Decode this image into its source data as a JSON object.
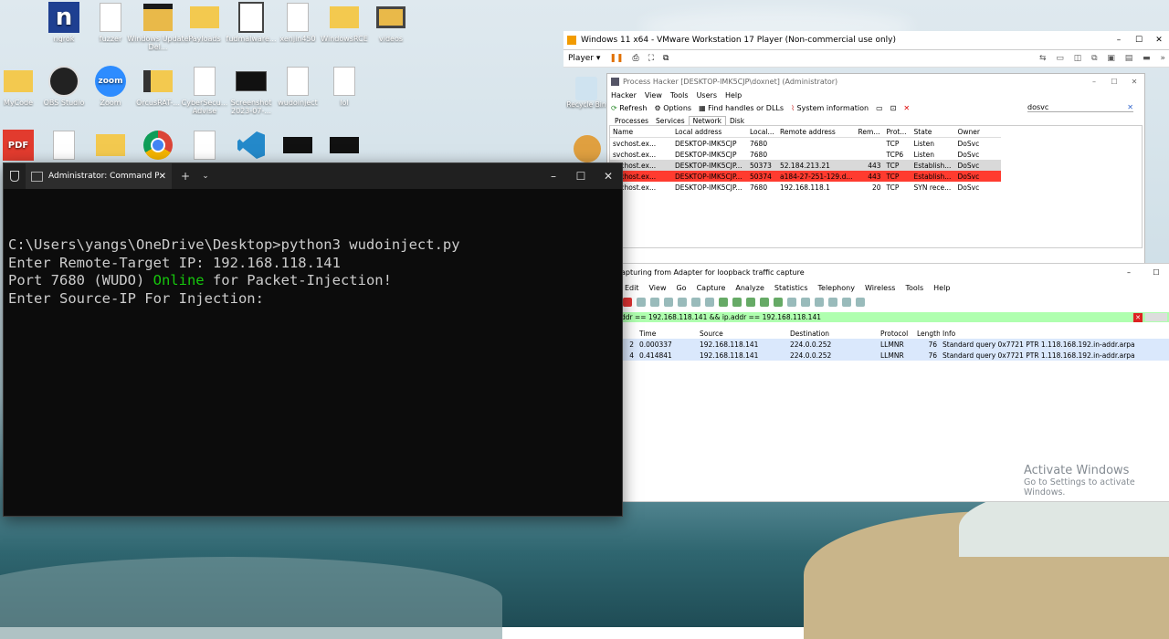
{
  "desktop": {
    "icons": [
      {
        "label": "ngrok",
        "icon": "ngrok-icon"
      },
      {
        "label": "fuzzer",
        "icon": "file-icon"
      },
      {
        "label": "Windows Update Del...",
        "icon": "folder-icon"
      },
      {
        "label": "Payloads",
        "icon": "folder-icon"
      },
      {
        "label": "fudmalware...",
        "icon": "notepadpp-icon"
      },
      {
        "label": "xenjin450",
        "icon": "file-icon"
      },
      {
        "label": "WindowsRCE",
        "icon": "folder-icon"
      },
      {
        "label": "videos",
        "icon": "folder-icon"
      },
      {
        "label": "MyCode",
        "icon": "folder-icon"
      },
      {
        "label": "OBS Studio",
        "icon": "obs-icon"
      },
      {
        "label": "Zoom",
        "icon": "zoom-icon"
      },
      {
        "label": "OrcusRAT-...",
        "icon": "folder-icon"
      },
      {
        "label": "CyberSecu... Advise",
        "icon": "file-icon"
      },
      {
        "label": "Screenshot 2023-07-...",
        "icon": "image-icon"
      },
      {
        "label": "wudoinject",
        "icon": "file-icon"
      },
      {
        "label": "lol",
        "icon": "file-icon"
      }
    ]
  },
  "cmd": {
    "tab_title": "Administrator: Command Pro",
    "lines": {
      "l1": "C:\\Users\\yangs\\OneDrive\\Desktop>python3 wudoinject.py",
      "l2": "Enter Remote-Target IP: 192.168.118.141",
      "l3a": "Port 7680 (WUDO) ",
      "l3b": "Online",
      "l3c": " for Packet-Injection!",
      "l4": "Enter Source-IP For Injection:"
    }
  },
  "vmware": {
    "title": "Windows 11 x64 - VMware Workstation 17 Player (Non-commercial use only)",
    "player_label": "Player"
  },
  "recycle_bin": "Recycle Bin",
  "process_hacker": {
    "title": "Process Hacker [DESKTOP-IMK5CJP\\doxnet] (Administrator)",
    "menu": [
      "Hacker",
      "View",
      "Tools",
      "Users",
      "Help"
    ],
    "toolbar": {
      "refresh": "Refresh",
      "options": "Options",
      "find": "Find handles or DLLs",
      "sysinfo": "System information"
    },
    "search_value": "dosvc",
    "tabs": [
      "Processes",
      "Services",
      "Network",
      "Disk"
    ],
    "columns": [
      "Name",
      "Local address",
      "Local...",
      "Remote address",
      "Rem...",
      "Prot...",
      "State",
      "Owner"
    ],
    "rows": [
      [
        "svchost.ex...",
        "DESKTOP-IMK5CJP",
        "7680",
        "",
        "",
        "TCP",
        "Listen",
        "DoSvc"
      ],
      [
        "svchost.ex...",
        "DESKTOP-IMK5CJP",
        "7680",
        "",
        "",
        "TCP6",
        "Listen",
        "DoSvc"
      ],
      [
        "svchost.ex...",
        "DESKTOP-IMK5CJP...",
        "50373",
        "52.184.213.21",
        "443",
        "TCP",
        "Establish...",
        "DoSvc"
      ],
      [
        "svchost.ex...",
        "DESKTOP-IMK5CJP...",
        "50374",
        "a184-27-251-129.d...",
        "443",
        "TCP",
        "Establish...",
        "DoSvc"
      ],
      [
        "svchost.ex...",
        "DESKTOP-IMK5CJP...",
        "7680",
        "192.168.118.1",
        "20",
        "TCP",
        "SYN rece...",
        "DoSvc"
      ]
    ]
  },
  "wireshark": {
    "title": "apturing from Adapter for loopback traffic capture",
    "menu": [
      "Edit",
      "View",
      "Go",
      "Capture",
      "Analyze",
      "Statistics",
      "Telephony",
      "Wireless",
      "Tools",
      "Help"
    ],
    "filter": "ddr == 192.168.118.141 && ip.addr == 192.168.118.141",
    "columns": [
      "Time",
      "Source",
      "Destination",
      "Protocol",
      "Length",
      "Info"
    ],
    "rows": [
      {
        "no": "2",
        "cells": [
          "0.000337",
          "192.168.118.141",
          "224.0.0.252",
          "LLMNR",
          "76",
          "Standard query 0x7721 PTR 1.118.168.192.in-addr.arpa"
        ]
      },
      {
        "no": "4",
        "cells": [
          "0.414841",
          "192.168.118.141",
          "224.0.0.252",
          "LLMNR",
          "76",
          "Standard query 0x7721 PTR 1.118.168.192.in-addr.arpa"
        ]
      }
    ]
  },
  "watermark": {
    "line1": "Activate Windows",
    "line2": "Go to Settings to activate Windows."
  }
}
